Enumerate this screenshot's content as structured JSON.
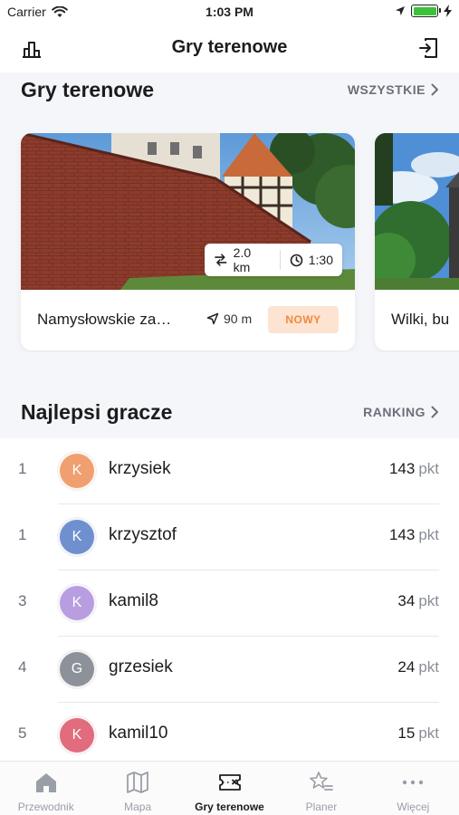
{
  "status": {
    "carrier": "Carrier",
    "time": "1:03 PM",
    "battery_level": 1.0
  },
  "nav": {
    "title": "Gry terenowe"
  },
  "games_section": {
    "title": "Gry terenowe",
    "link": "WSZYSTKIE"
  },
  "cards": [
    {
      "name": "Namysłowskie za…",
      "length": "2.0 km",
      "time": "1:30",
      "distance": "90 m",
      "badge": "NOWY"
    },
    {
      "name": "Wilki, bu"
    }
  ],
  "players_section": {
    "title": "Najlepsi gracze",
    "link": "RANKING"
  },
  "players": [
    {
      "rank": "1",
      "initial": "K",
      "name": "krzysiek",
      "points": "143",
      "unit": "pkt",
      "color": "#f0a070"
    },
    {
      "rank": "1",
      "initial": "K",
      "name": "krzysztof",
      "points": "143",
      "unit": "pkt",
      "color": "#6f8fce"
    },
    {
      "rank": "3",
      "initial": "K",
      "name": "kamil8",
      "points": "34",
      "unit": "pkt",
      "color": "#b89ee0"
    },
    {
      "rank": "4",
      "initial": "G",
      "name": "grzesiek",
      "points": "24",
      "unit": "pkt",
      "color": "#8d9199"
    },
    {
      "rank": "5",
      "initial": "K",
      "name": "kamil10",
      "points": "15",
      "unit": "pkt",
      "color": "#e06c7e"
    }
  ],
  "tabs": [
    {
      "label": "Przewodnik",
      "icon": "home-icon"
    },
    {
      "label": "Mapa",
      "icon": "map-icon"
    },
    {
      "label": "Gry terenowe",
      "icon": "game-ticket-icon",
      "active": true
    },
    {
      "label": "Planer",
      "icon": "star-list-icon"
    },
    {
      "label": "Więcej",
      "icon": "more-icon"
    }
  ]
}
